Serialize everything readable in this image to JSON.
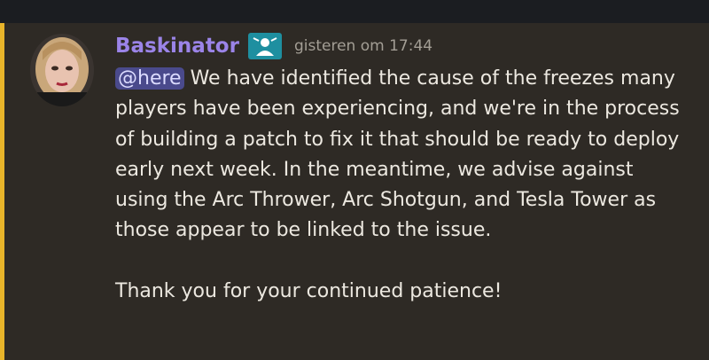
{
  "message": {
    "author": "Baskinator",
    "timestamp": "gisteren om 17:44",
    "mention": "@here",
    "body_text": "We have identified the cause of the freezes many players have been experiencing, and we're in the process of building a patch to fix it that should be ready to deploy early next week. In the meantime, we advise against using the Arc Thrower, Arc Shotgun, and Tesla Tower as those appear to be linked to the issue.",
    "closing_text": "Thank you for your continued patience!",
    "role_icon": "role-badge-icon"
  },
  "colors": {
    "background": "#2e2a25",
    "mention_bar": "#e8b42a",
    "username": "#9b84e8",
    "mention_bg": "#4a4a8c",
    "role_badge": "#1e8fa0"
  }
}
